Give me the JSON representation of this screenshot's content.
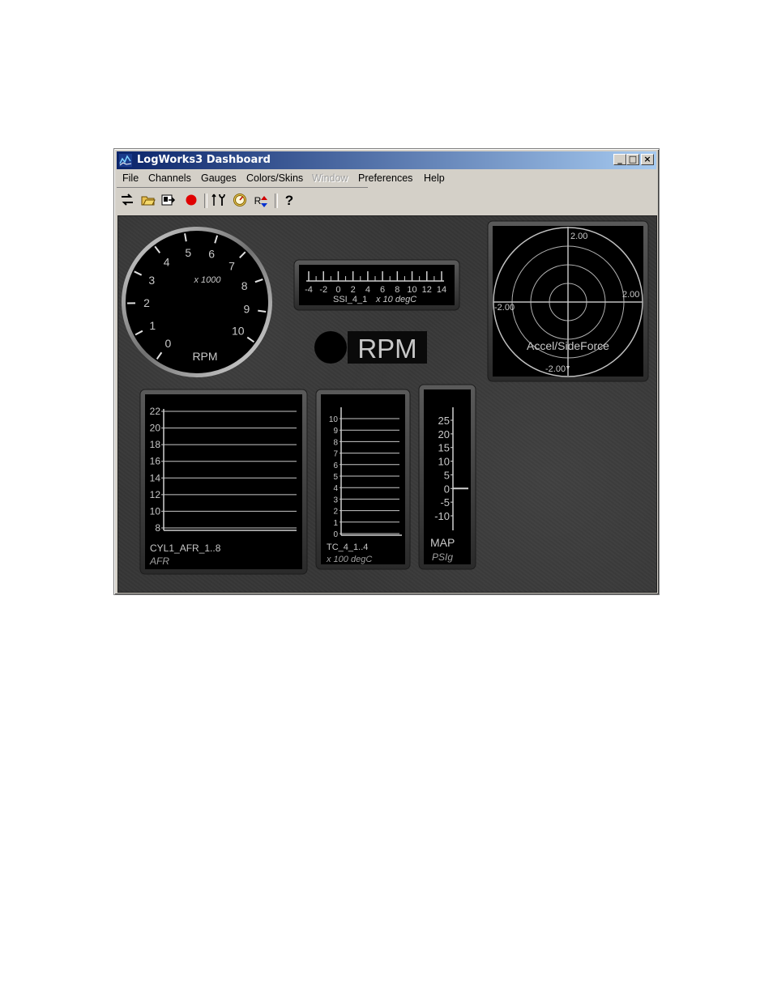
{
  "window": {
    "title": "LogWorks3 Dashboard",
    "minimize": "_",
    "maximize": "□",
    "close": "×"
  },
  "menu": [
    {
      "label": "File",
      "enabled": true
    },
    {
      "label": "Channels",
      "enabled": true
    },
    {
      "label": "Gauges",
      "enabled": true
    },
    {
      "label": "Colors/Skins",
      "enabled": true
    },
    {
      "label": "Window",
      "enabled": false
    },
    {
      "label": "Preferences",
      "enabled": true
    },
    {
      "label": "Help",
      "enabled": true
    }
  ],
  "toolbar": {
    "icons": [
      "connect-icon",
      "open-folder-icon",
      "export-icon",
      "record-icon",
      "tools-icon",
      "gauge-icon",
      "r-arrows-icon",
      "help-icon"
    ],
    "r_label": "R",
    "help_label": "?"
  },
  "gauges": {
    "rpm_dial": {
      "ticks": [
        "0",
        "1",
        "2",
        "3",
        "4",
        "5",
        "6",
        "7",
        "8",
        "9",
        "10"
      ],
      "multiplier": "x 1000",
      "label": "RPM",
      "value": 0
    },
    "ssi": {
      "ticks": [
        "-4",
        "-2",
        "0",
        "2",
        "4",
        "6",
        "8",
        "10",
        "12",
        "14"
      ],
      "channel": "SSI_4_1",
      "unit": "x 10 degC"
    },
    "rpm_digital": {
      "label": "RPM",
      "indicator_color": "#000000"
    },
    "accel": {
      "top": "2.00",
      "right": "2.00",
      "left": "-2.00",
      "bottom": "-2.00",
      "label": "Accel/SideForce"
    },
    "afr": {
      "ticks": [
        "22",
        "20",
        "18",
        "16",
        "14",
        "12",
        "10",
        "8"
      ],
      "channel": "CYL1_AFR_1..8",
      "unit": "AFR"
    },
    "tc": {
      "ticks": [
        "10",
        "9",
        "8",
        "7",
        "6",
        "5",
        "4",
        "3",
        "2",
        "1",
        "0"
      ],
      "channel": "TC_4_1..4",
      "unit": "x 100 degC"
    },
    "map": {
      "ticks": [
        "25",
        "20",
        "15",
        "10",
        "5",
        "0",
        "-5",
        "-10"
      ],
      "channel": "MAP",
      "unit": "PSIg",
      "value": 0
    }
  }
}
